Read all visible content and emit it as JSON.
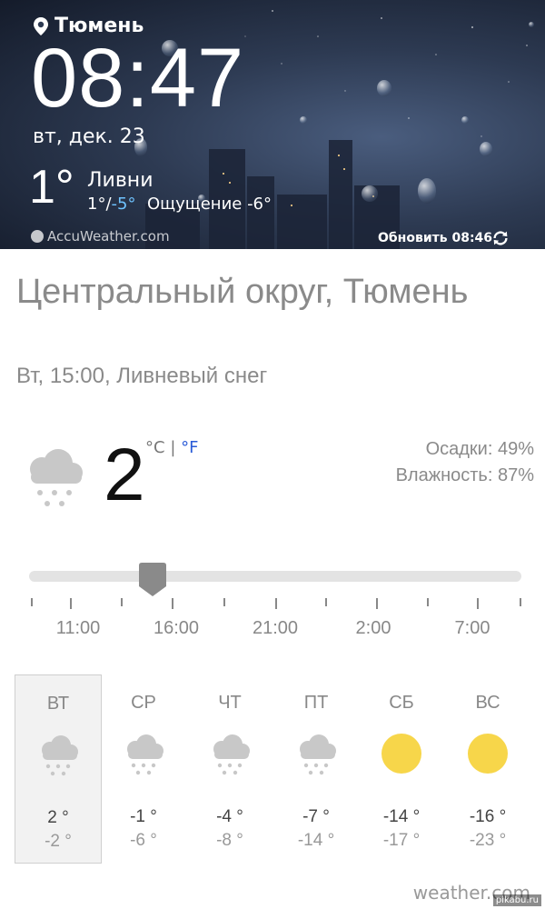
{
  "widget": {
    "city": "Тюмень",
    "time": "08:47",
    "date": "вт, дек. 23",
    "temp": "1°",
    "condition": "Ливни",
    "range_hi": "1°",
    "range_sep": "/",
    "range_lo": "-5°",
    "feels_like": "Ощущение -6°",
    "brand": "AccuWeather.com",
    "updated": "Обновить 08:46"
  },
  "main": {
    "location": "Центральный округ, Тюмень",
    "subline": "Вт, 15:00, Ливневый снег",
    "current_temp": "2",
    "unit_c": "°C",
    "unit_sep": "|",
    "unit_f": "°F",
    "precip": "Осадки: 49%",
    "humidity": "Влажность: 87%",
    "slider_value_fraction": 0.25,
    "timeline_labels": [
      "11:00",
      "16:00",
      "21:00",
      "2:00",
      "7:00"
    ]
  },
  "days": [
    {
      "name": "ВТ",
      "icon": "snow-cloud-icon",
      "hi": "2 °",
      "lo": "-2 °",
      "selected": true
    },
    {
      "name": "СР",
      "icon": "snow-cloud-icon",
      "hi": "-1 °",
      "lo": "-6 °",
      "selected": false
    },
    {
      "name": "ЧТ",
      "icon": "snow-cloud-icon",
      "hi": "-4 °",
      "lo": "-8 °",
      "selected": false
    },
    {
      "name": "ПТ",
      "icon": "snow-cloud-icon",
      "hi": "-7 °",
      "lo": "-14 °",
      "selected": false
    },
    {
      "name": "СБ",
      "icon": "sun-icon",
      "hi": "-14 °",
      "lo": "-17 °",
      "selected": false
    },
    {
      "name": "ВС",
      "icon": "sun-icon",
      "hi": "-16 °",
      "lo": "-23 °",
      "selected": false
    }
  ],
  "footer": {
    "brand": "weather.com",
    "watermark": "pikabu.ru"
  },
  "colors": {
    "sun": "#f7d64a",
    "snow_icon": "#c8c8c8",
    "fahrenheit": "#2a5bd7",
    "range_low": "#6fc3ff"
  }
}
